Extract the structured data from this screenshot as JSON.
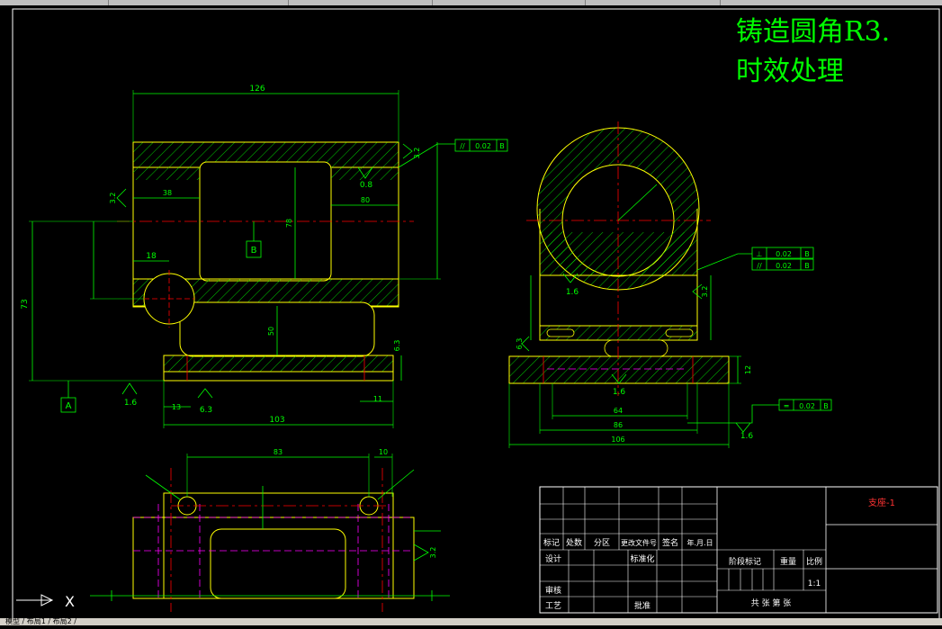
{
  "notes": {
    "line1": "铸造圆角R3.",
    "line2": "时效处理"
  },
  "dimensions": {
    "top_width": "126",
    "inner_depth": "78",
    "side_height": "73",
    "bore_small": "18",
    "base_width": "103",
    "base_half": "11",
    "left_shift": "13",
    "mid_dim": "38",
    "right_len": "80",
    "center_ht": "50",
    "bottom_top": "83",
    "bottom_side": "10",
    "front_w1": "64",
    "front_w2": "86",
    "front_w3": "106",
    "front_ht": "12"
  },
  "datums": {
    "a": "A",
    "b": "B"
  },
  "surface": {
    "r08": "0.8",
    "r16a": "1.6",
    "r16b": "1.6",
    "r16c": "1.6",
    "r16d": "1.6",
    "r63": "6.3",
    "r32a": "3.2",
    "r32b": "3.2",
    "r32c": "3.2",
    "r32d": "3.2",
    "r63b": "6.3",
    "r63c": "6.3"
  },
  "tolerances": {
    "t1_sym": "//",
    "t1_val": "0.02",
    "t1_ref": "B",
    "t2_sym": "⊥",
    "t2_val": "0.02",
    "t2_ref": "B",
    "t3_sym": "//",
    "t3_val": "0.02",
    "t3_ref": "B",
    "t4_sym": "═",
    "t4_val": "0.02",
    "t4_ref": "B"
  },
  "title_block": {
    "drawing_name": "支座-1",
    "mark": "标记",
    "count": "处数",
    "zone": "分区",
    "doc_no": "更改文件号",
    "sign": "签名",
    "date": "年.月.日",
    "design": "设计",
    "standard": "标准化",
    "stage": "阶段标记",
    "weight": "重量",
    "scale": "比例",
    "scale_val": "1:1",
    "review": "审核",
    "process": "工艺",
    "approve": "批准",
    "sheets": "共 张 第 张"
  },
  "ucs": {
    "x": "X"
  },
  "status": {
    "tabs": "模型 / 布局1 / 布局2 /"
  },
  "colors": {
    "bg": "#000000",
    "line": "#00ff00",
    "outline": "#ffff00",
    "center": "#ff0000",
    "hidden": "#ff00ff",
    "text": "#ffffff",
    "dim": "#00ff00"
  }
}
